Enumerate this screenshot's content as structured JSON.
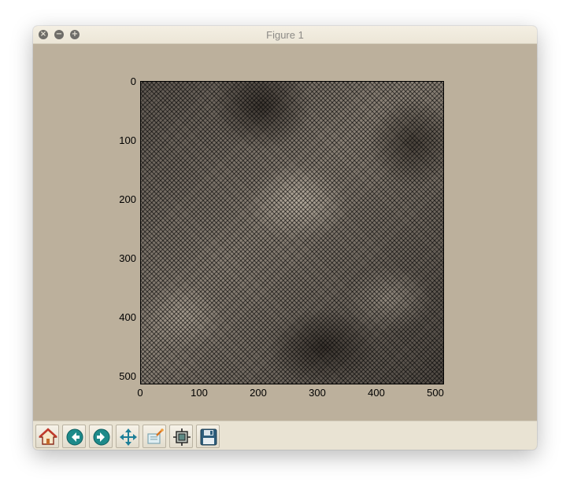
{
  "window": {
    "title": "Figure 1",
    "buttons": {
      "close": "×",
      "minimize": "−",
      "maximize": "+"
    }
  },
  "plot": {
    "type": "image",
    "y_ticks": [
      "0",
      "100",
      "200",
      "300",
      "400",
      "500"
    ],
    "x_ticks": [
      "0",
      "100",
      "200",
      "300",
      "400",
      "500"
    ],
    "x_range": [
      0,
      512
    ],
    "y_range": [
      0,
      512
    ]
  },
  "toolbar": {
    "tools": [
      {
        "name": "home-button",
        "icon": "home-icon"
      },
      {
        "name": "back-button",
        "icon": "back-arrow-icon"
      },
      {
        "name": "forward-button",
        "icon": "forward-arrow-icon"
      },
      {
        "name": "pan-button",
        "icon": "move-arrows-icon"
      },
      {
        "name": "zoom-button",
        "icon": "zoom-rect-icon"
      },
      {
        "name": "subplots-button",
        "icon": "subplots-icon"
      },
      {
        "name": "save-button",
        "icon": "floppy-disk-icon"
      }
    ]
  },
  "colors": {
    "figure_bg": "#bcb09c",
    "toolbar_bg": "#e9e3d3",
    "titlebar_bg": "#f0eadc"
  }
}
